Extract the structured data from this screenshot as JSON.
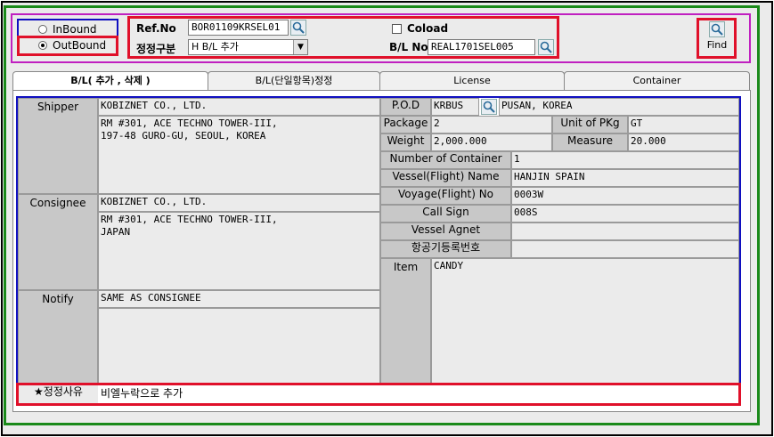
{
  "header": {
    "inbound_label": "InBound",
    "outbound_label": "OutBound",
    "ref_label": "Ref.No",
    "ref_value": "BOR01109KRSEL01",
    "correction_type_label": "정정구분",
    "correction_type_value": "H B/L 추가",
    "coload_label": "Coload",
    "bl_label": "B/L No",
    "bl_value": "REAL1701SEL005",
    "find_label": "Find"
  },
  "tabs": [
    {
      "label": "B/L( 추가 , 삭제 )"
    },
    {
      "label": "B/L(단일항목)정정"
    },
    {
      "label": "License"
    },
    {
      "label": "Container"
    }
  ],
  "form": {
    "shipper_label": "Shipper",
    "shipper_name": "KOBIZNET CO., LTD.",
    "shipper_address": "RM #301, ACE TECHNO TOWER-III,\n197-48 GURO-GU, SEOUL, KOREA",
    "consignee_label": "Consignee",
    "consignee_name": "KOBIZNET CO., LTD.",
    "consignee_address": "RM #301, ACE TECHNO TOWER-III,\nJAPAN",
    "notify_label": "Notify",
    "notify_value": "SAME AS CONSIGNEE",
    "pod_label": "P.O.D",
    "pod_code": "KRBUS",
    "pod_name": "PUSAN, KOREA",
    "package_label": "Package",
    "package_value": "2",
    "unit_pkg_label": "Unit of PKg",
    "unit_pkg_value": "GT",
    "weight_label": "Weight",
    "weight_value": "2,000.000",
    "measure_label": "Measure",
    "measure_value": "20.000",
    "num_container_label": "Number of Container",
    "num_container_value": "1",
    "vessel_label": "Vessel(Flight) Name",
    "vessel_value": "HANJIN SPAIN",
    "voyage_label": "Voyage(Flight) No",
    "voyage_value": "0003W",
    "call_sign_label": "Call Sign",
    "call_sign_value": "008S",
    "vessel_agent_label": "Vessel Agnet",
    "vessel_agent_value": "",
    "aircraft_reg_label": "항공기등록번호",
    "aircraft_reg_value": "",
    "item_label": "Item",
    "item_value": "CANDY",
    "reason_label": "★정정사유",
    "reason_value": "비엘누락으로 추가"
  },
  "colors": {
    "red_box": "#e0102a",
    "blue_box": "#1010c0",
    "green_frame": "#1a8a1a",
    "magenta_frame": "#c020c0"
  }
}
